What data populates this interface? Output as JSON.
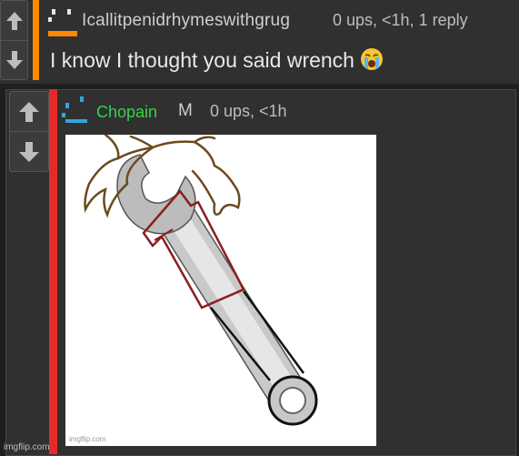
{
  "comment1": {
    "username": "Icallitpenidrhymeswithgrug",
    "meta": "0 ups, <1h, 1 reply",
    "text": "I know I thought you said wrench",
    "emoji": "loudly-crying-face",
    "thread_color": "#ff8a00",
    "avatar_icon": "pixel-face-icon"
  },
  "comment2": {
    "username": "Chopain",
    "flair": "M",
    "meta": "0 ups, <1h",
    "thread_color": "#e8292a",
    "username_color": "#3bd24a",
    "avatar_icon": "pixel-face-icon",
    "image": {
      "description_icon": "wrench-with-hair-drawing",
      "watermark": "imgflip.com"
    }
  },
  "watermark": "imgflip.com"
}
